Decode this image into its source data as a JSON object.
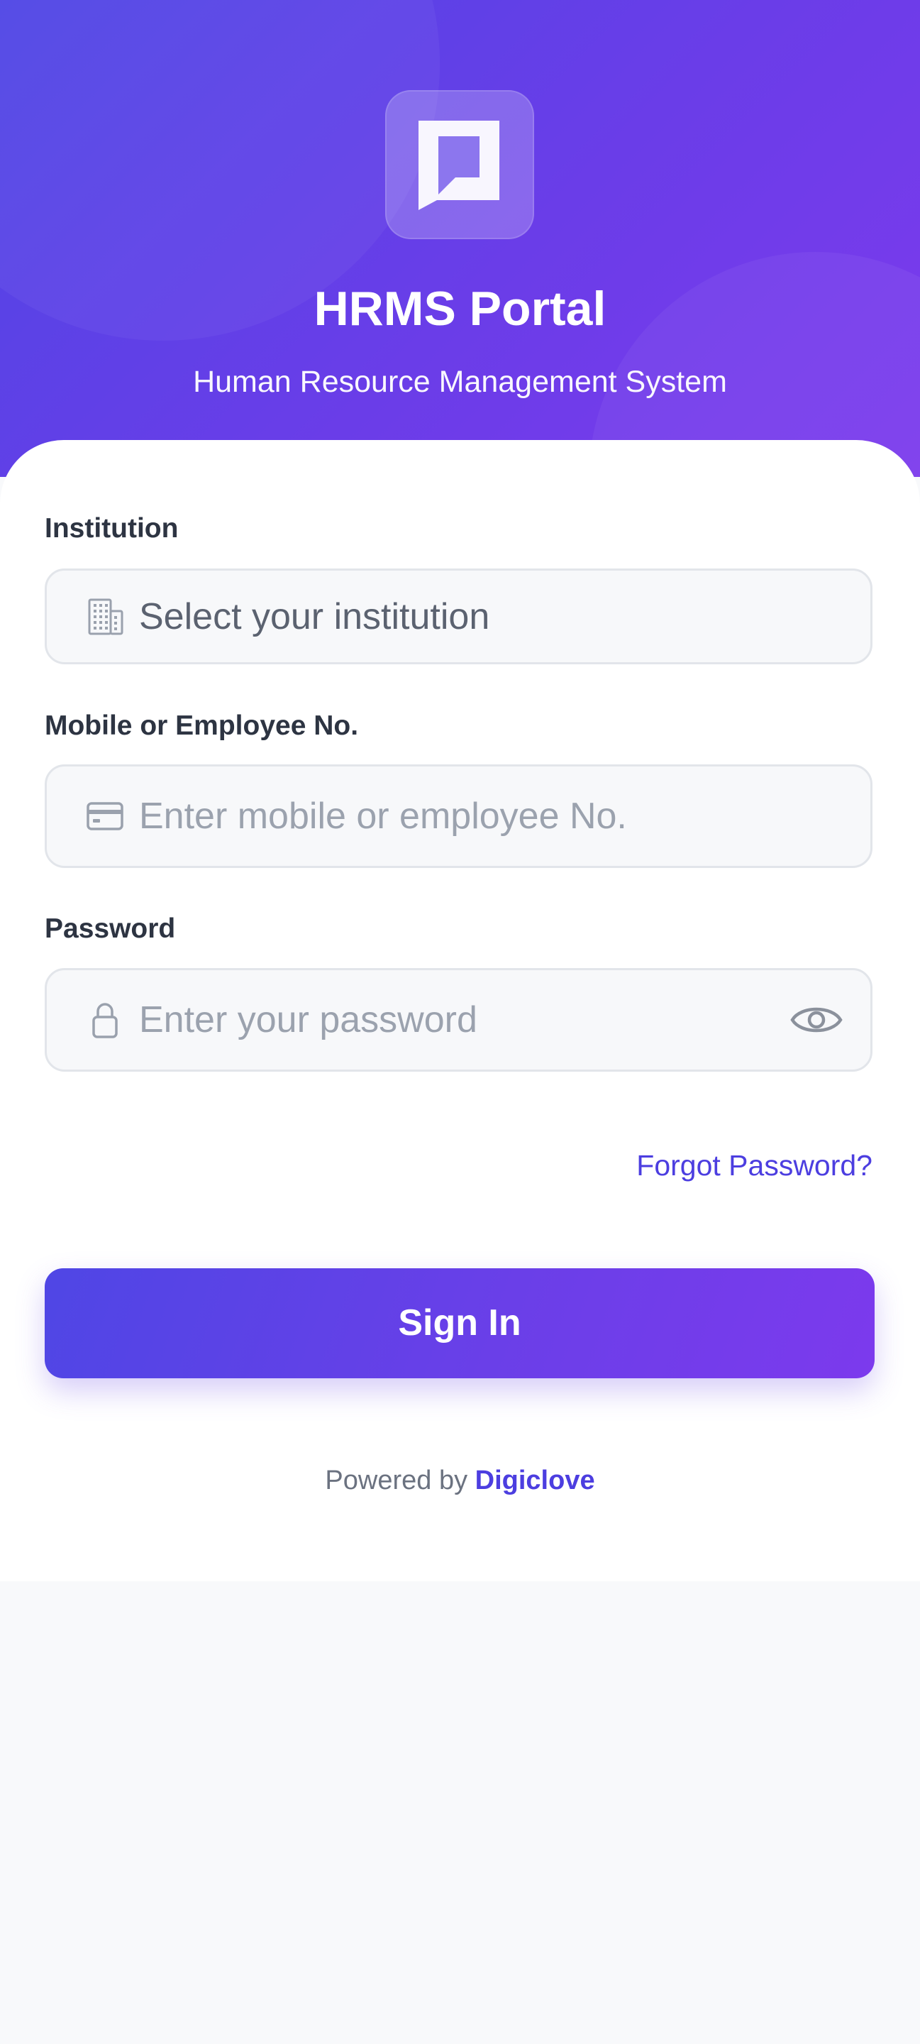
{
  "header": {
    "title": "HRMS Portal",
    "subtitle": "Human Resource Management System",
    "logo_icon": "chat-square-logo-icon"
  },
  "form": {
    "institution": {
      "label": "Institution",
      "value": "Select your institution",
      "icon": "building-icon"
    },
    "employee_id": {
      "label": "Mobile or Employee No.",
      "placeholder": "Enter mobile or employee No.",
      "icon": "id-card-icon"
    },
    "password": {
      "label": "Password",
      "placeholder": "Enter your password",
      "icon": "lock-icon",
      "toggle_icon": "eye-icon"
    },
    "forgot_password": "Forgot Password?",
    "submit_label": "Sign In"
  },
  "footer": {
    "prefix": "Powered by",
    "brand": "Digiclove"
  },
  "colors": {
    "primary": "#4f46e5",
    "primary_end": "#7c3aed",
    "link": "#4c3ee0",
    "label_text": "#2d3442",
    "placeholder": "#9ba2ae",
    "page_background": "#f8f9fb"
  }
}
